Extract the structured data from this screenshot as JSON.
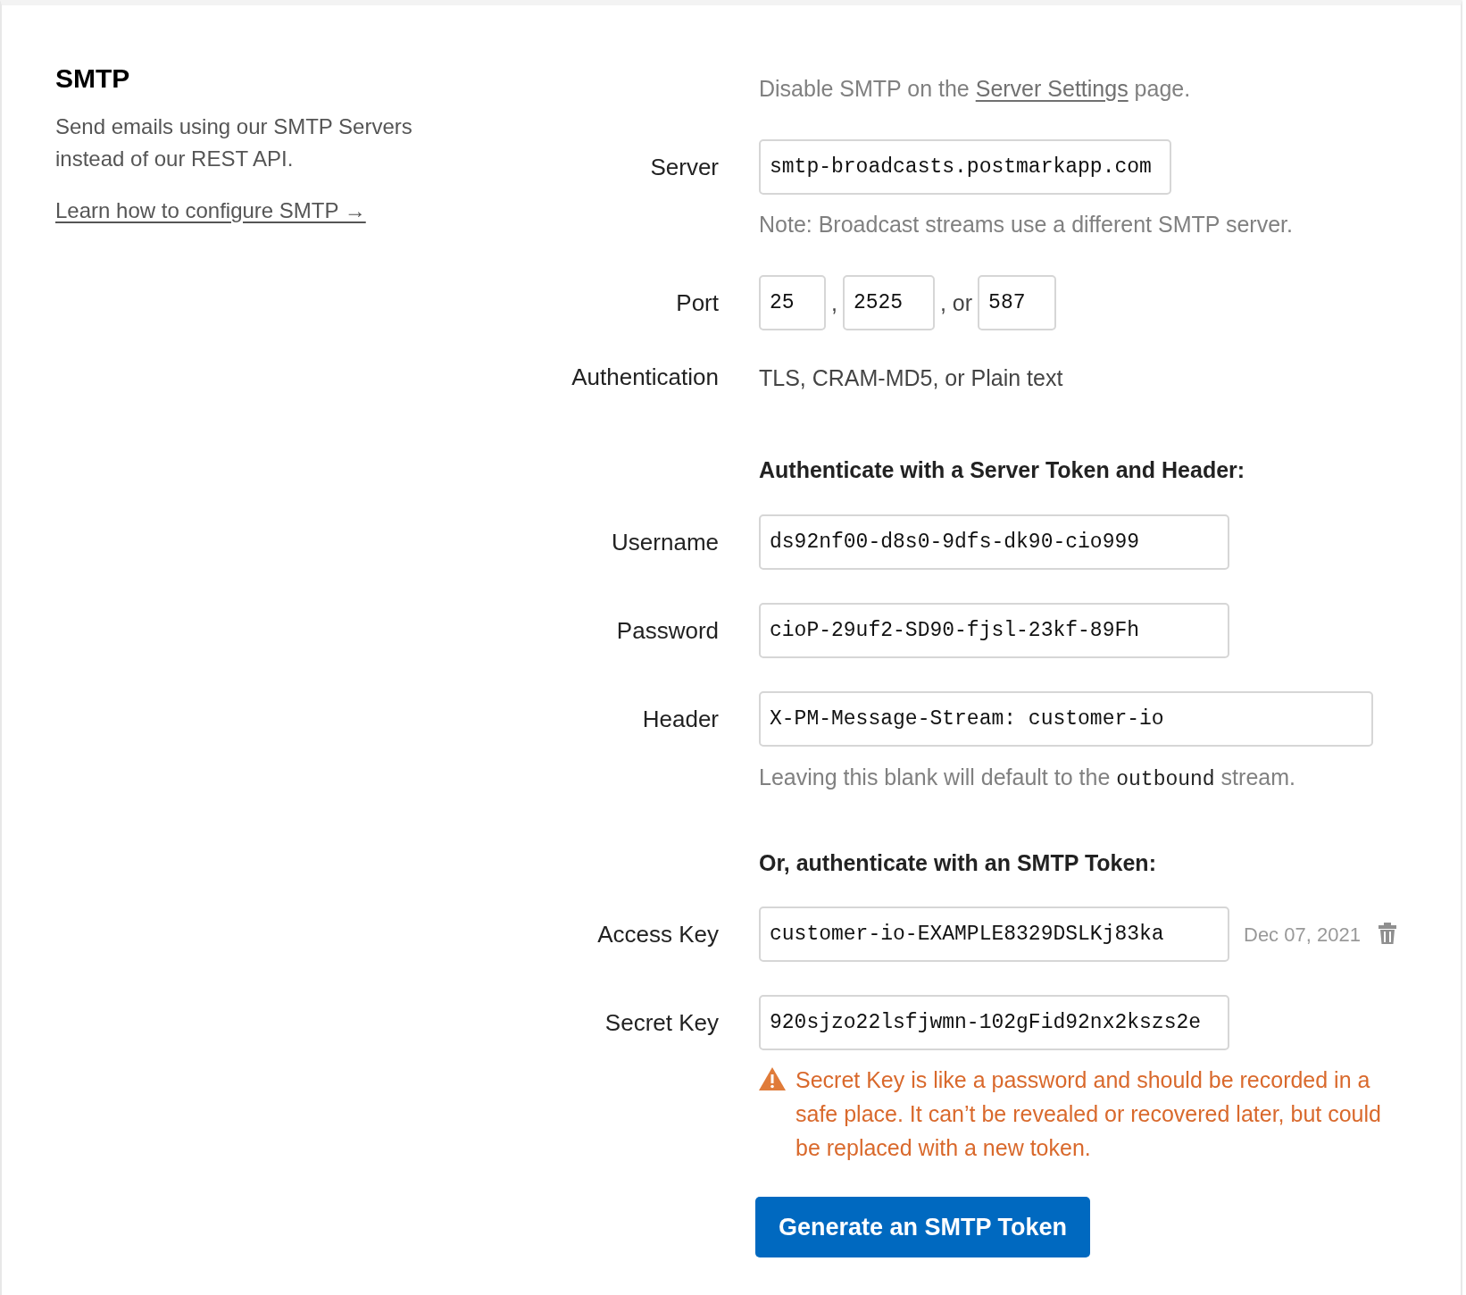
{
  "intro": {
    "title": "SMTP",
    "description": "Send emails using our SMTP Servers instead of our REST API.",
    "link": "Learn how to configure SMTP →"
  },
  "disable_note": {
    "before": "Disable SMTP on the ",
    "link": "Server Settings",
    "after": " page."
  },
  "server": {
    "label": "Server",
    "value": "smtp-broadcasts.postmarkapp.com",
    "note": "Note: Broadcast streams use a different SMTP server."
  },
  "port": {
    "label": "Port",
    "values": [
      "25",
      "2525",
      "587"
    ],
    "separators": [
      ",",
      ", or"
    ]
  },
  "authentication": {
    "label": "Authentication",
    "value": "TLS, CRAM-MD5, or Plain text"
  },
  "header_auth": {
    "heading": "Authenticate with a Server Token and Header:",
    "username": {
      "label": "Username",
      "value": "ds92nf00-d8s0-9dfs-dk90-cio999"
    },
    "password": {
      "label": "Password",
      "value": "cioP-29uf2-SD90-fjsl-23kf-89Fh"
    },
    "header": {
      "label": "Header",
      "value": "X-PM-Message-Stream: customer-io",
      "hint_before": "Leaving this blank will default to the ",
      "hint_code": "outbound",
      "hint_after": " stream."
    }
  },
  "token_auth": {
    "heading": "Or, authenticate with an SMTP Token:",
    "access_key": {
      "label": "Access Key",
      "value": "customer-io-EXAMPLE8329DSLKj83ka",
      "date": "Dec 07, 2021"
    },
    "secret_key": {
      "label": "Secret Key",
      "value": "920sjzo22lsfjwmn-102gFid92nx2kszs2e"
    },
    "warning": "Secret Key is like a password and should be recorded in a safe place. It can’t be revealed or recovered later, but could be replaced with a new token.",
    "button": "Generate an SMTP Token"
  }
}
